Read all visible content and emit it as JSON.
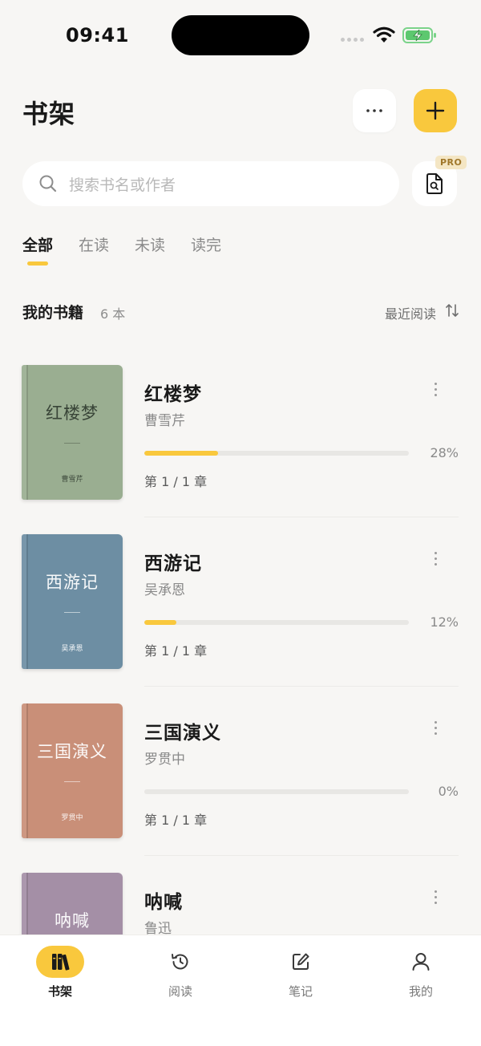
{
  "status_bar": {
    "time": "09:41"
  },
  "header": {
    "title": "书架"
  },
  "search": {
    "placeholder": "搜索书名或作者",
    "pro_badge": "PRO"
  },
  "filter_tabs": [
    {
      "label": "全部",
      "active": true
    },
    {
      "label": "在读",
      "active": false
    },
    {
      "label": "未读",
      "active": false
    },
    {
      "label": "读完",
      "active": false
    }
  ],
  "section": {
    "title": "我的书籍",
    "count": "6 本",
    "sort_label": "最近阅读"
  },
  "books": [
    {
      "title": "红楼梦",
      "author": "曹雪芹",
      "progress_label": "28%",
      "progress": 0.28,
      "chapter": "第 1 / 1 章",
      "cover_color": "#9aae91"
    },
    {
      "title": "西游记",
      "author": "吴承恩",
      "progress_label": "12%",
      "progress": 0.12,
      "chapter": "第 1 / 1 章",
      "cover_color": "#6d8ea3"
    },
    {
      "title": "三国演义",
      "author": "罗贯中",
      "progress_label": "0%",
      "progress": 0.0,
      "chapter": "第 1 / 1 章",
      "cover_color": "#c98f78"
    },
    {
      "title": "呐喊",
      "author": "鲁迅",
      "progress_label": "",
      "progress": 0.0,
      "chapter": "",
      "cover_color": "#a48fa6"
    }
  ],
  "bottom_tabs": [
    {
      "label": "书架",
      "icon": "books-icon",
      "active": true
    },
    {
      "label": "阅读",
      "icon": "history-icon",
      "active": false
    },
    {
      "label": "笔记",
      "icon": "edit-icon",
      "active": false
    },
    {
      "label": "我的",
      "icon": "user-icon",
      "active": false
    }
  ],
  "colors": {
    "accent": "#f9c83d",
    "background": "#f7f6f4"
  }
}
